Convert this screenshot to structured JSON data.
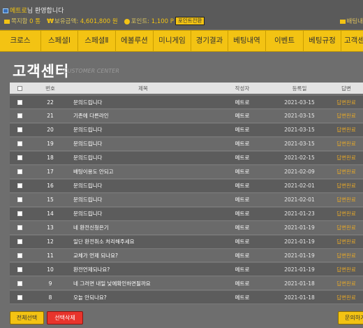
{
  "header": {
    "nickname": "메트로",
    "welcome_suffix": "님 환영합니다",
    "note_label": "쪽지함",
    "note_count": "0 통",
    "money_label": "보유금액",
    "money_value": ": 4,601,800 원",
    "point_label": "포인트",
    "point_value": ": 1,100 P",
    "point_convert_button": "포인트전환",
    "bet_link": "배팅내"
  },
  "nav": {
    "items": [
      "크로스",
      "스페셜Ⅰ",
      "스페셜Ⅱ",
      "에볼루션",
      "미니게임",
      "경기결과",
      "베팅내역",
      "이벤트",
      "베팅규정",
      "고객센"
    ]
  },
  "page": {
    "title": "고객센터",
    "subtitle": "CUSTOMER CENTER"
  },
  "table": {
    "headers": {
      "num": "번호",
      "title": "제목",
      "author": "작성자",
      "date": "등록일",
      "answer": "답변"
    },
    "rows": [
      {
        "num": "22",
        "title": "문의드립니다",
        "author": "메트로",
        "date": "2021-03-15",
        "answer": "답변완료"
      },
      {
        "num": "21",
        "title": "기존에 다른라인",
        "author": "메트로",
        "date": "2021-03-15",
        "answer": "답변완료"
      },
      {
        "num": "20",
        "title": "문의드립니다",
        "author": "메트로",
        "date": "2021-03-15",
        "answer": "답변완료"
      },
      {
        "num": "19",
        "title": "문의드립니다",
        "author": "메트로",
        "date": "2021-03-15",
        "answer": "답변완료"
      },
      {
        "num": "18",
        "title": "문의드립니다",
        "author": "메트로",
        "date": "2021-02-15",
        "answer": "답변완료"
      },
      {
        "num": "17",
        "title": "배팅이용도 안되고",
        "author": "메트로",
        "date": "2021-02-09",
        "answer": "답변완료"
      },
      {
        "num": "16",
        "title": "문의드립니다",
        "author": "메트로",
        "date": "2021-02-01",
        "answer": "답변완료"
      },
      {
        "num": "15",
        "title": "문의드립니다",
        "author": "메트로",
        "date": "2021-02-01",
        "answer": "답변완료"
      },
      {
        "num": "14",
        "title": "문의드립니다",
        "author": "메트로",
        "date": "2021-01-23",
        "answer": "답변완료"
      },
      {
        "num": "13",
        "title": "네 환전신청은기",
        "author": "메트로",
        "date": "2021-01-19",
        "answer": "답변완료"
      },
      {
        "num": "12",
        "title": "일단 환전취소 처리해주세요",
        "author": "메트로",
        "date": "2021-01-19",
        "answer": "답변완료"
      },
      {
        "num": "11",
        "title": "교체가 언제 되나요?",
        "author": "메트로",
        "date": "2021-01-19",
        "answer": "답변완료"
      },
      {
        "num": "10",
        "title": "환전언제되나요?",
        "author": "메트로",
        "date": "2021-01-19",
        "answer": "답변완료"
      },
      {
        "num": "9",
        "title": "네 그러면 내일 낮에확인하면될까요",
        "author": "메트로",
        "date": "2021-01-18",
        "answer": "답변완료"
      },
      {
        "num": "8",
        "title": "오늘 안되나요?",
        "author": "메트로",
        "date": "2021-01-18",
        "answer": "답변완료"
      }
    ]
  },
  "footer": {
    "select_all": "전체선택",
    "delete_selected": "선택삭제",
    "ask": "문의하기"
  },
  "colors": {
    "accent": "#f3c313",
    "answer": "#e1a52a",
    "delete": "#e8342c",
    "background": "#6e6e6e"
  }
}
